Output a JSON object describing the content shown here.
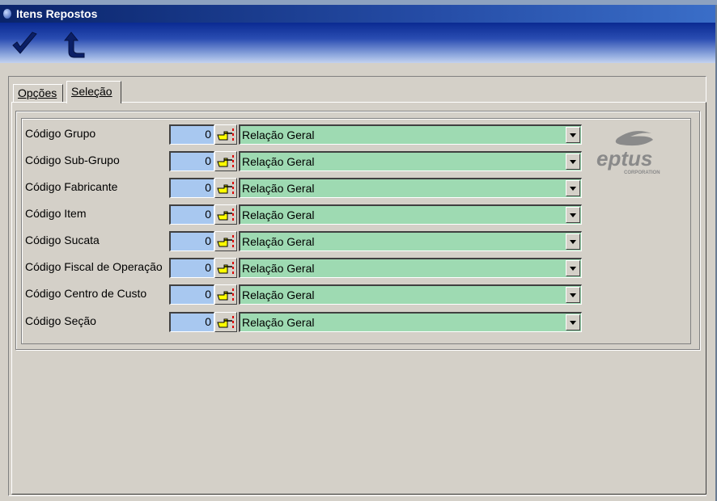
{
  "window": {
    "title": "Itens Repostos"
  },
  "toolbar": {
    "confirm_icon": "checkmark-icon",
    "back_icon": "return-arrow-icon"
  },
  "tabs": [
    {
      "label": "Opções",
      "active": false
    },
    {
      "label": "Seleção",
      "active": true
    }
  ],
  "form": {
    "rows": [
      {
        "label": "Código Grupo",
        "value": "0",
        "selection": "Relação Geral"
      },
      {
        "label": "Código Sub-Grupo",
        "value": "0",
        "selection": "Relação Geral"
      },
      {
        "label": "Código Fabricante",
        "value": "0",
        "selection": "Relação Geral"
      },
      {
        "label": "Código Item",
        "value": "0",
        "selection": "Relação Geral"
      },
      {
        "label": "Código Sucata",
        "value": "0",
        "selection": "Relação Geral"
      },
      {
        "label": "Código Fiscal de Operação",
        "value": "0",
        "selection": "Relação Geral"
      },
      {
        "label": "Código Centro de Custo",
        "value": "0",
        "selection": "Relação Geral"
      },
      {
        "label": "Código Seção",
        "value": "0",
        "selection": "Relação Geral"
      }
    ]
  },
  "logo": {
    "text": "eptus",
    "subtext": "CORPORATION"
  },
  "colors": {
    "numeric_field": "#a8c8f0",
    "combo_field": "#9edab2",
    "title_bar": "#0a246a"
  }
}
